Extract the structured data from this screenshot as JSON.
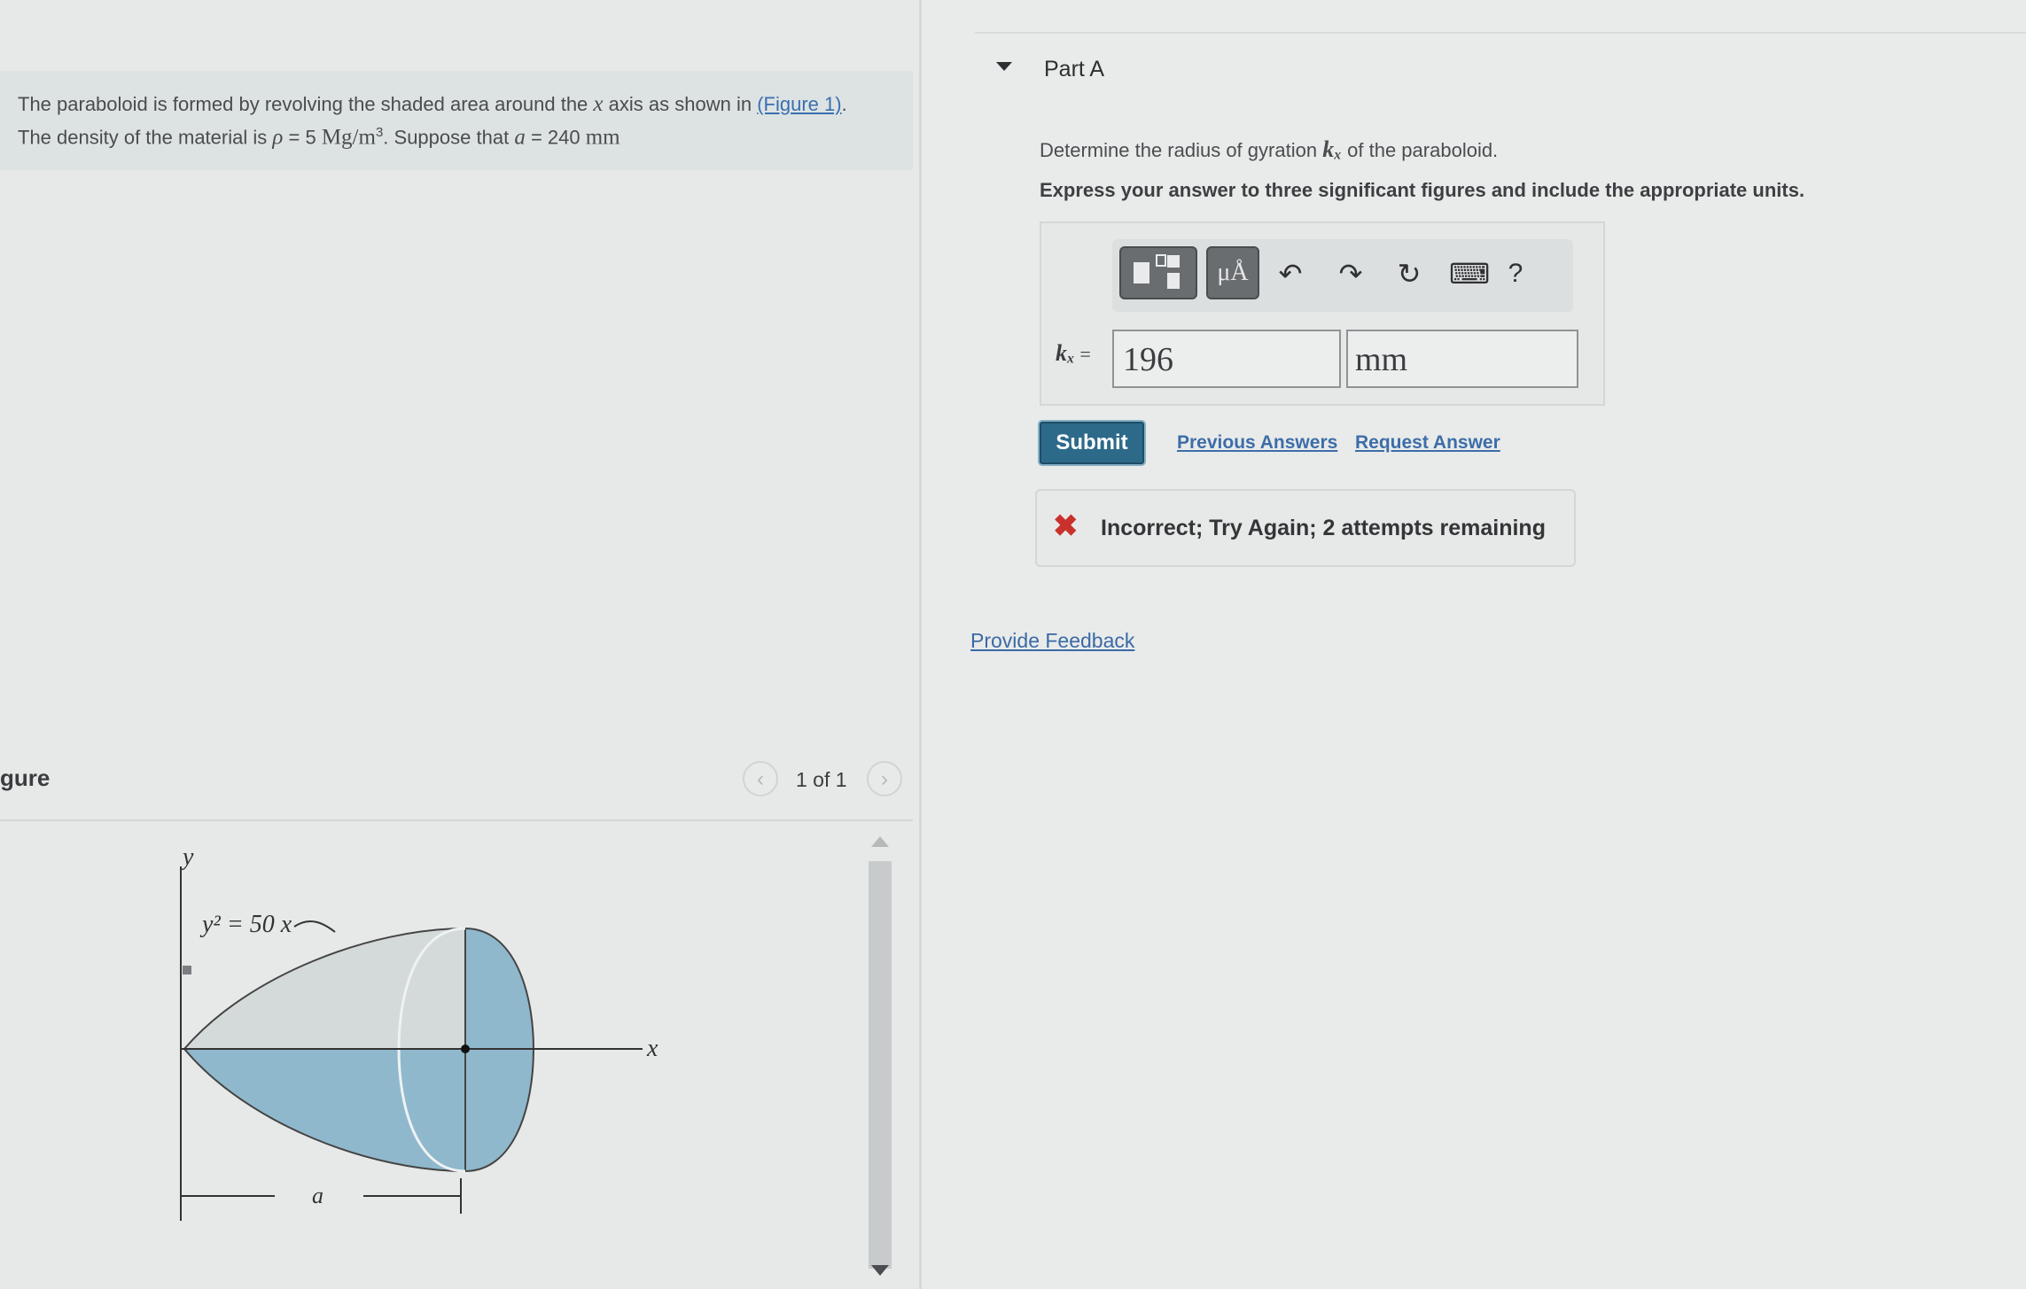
{
  "problem": {
    "line1_prefix": "The paraboloid is formed by revolving the shaded area around the",
    "axis": "x",
    "line1_mid": "axis as shown in",
    "figure_link": "(Figure 1)",
    "line1_end": ".",
    "line2_prefix": "The density of the material is",
    "rho_symbol": "ρ",
    "rho_value": "= 5",
    "rho_unit": "Mg/m",
    "rho_exp": "3",
    "line2_mid": ". Suppose that",
    "a_symbol": "a",
    "a_value": "= 240",
    "a_unit": "mm"
  },
  "figure": {
    "title": "gure",
    "pager_count": "1 of 1",
    "prev_glyph": "‹",
    "next_glyph": "›",
    "equation": "y² = 50 x",
    "y_axis_label": "y",
    "x_axis_label": "x",
    "a_label": "a"
  },
  "part": {
    "title": "Part A",
    "question_prefix": "Determine the radius of gyration",
    "question_var": "kₓ",
    "question_suffix": "of the paraboloid.",
    "instruction": "Express your answer to three significant figures and include the appropriate units."
  },
  "toolbar": {
    "units_label": "μÅ",
    "undo_glyph": "↶",
    "redo_glyph": "↷",
    "reset_glyph": "↻",
    "keyboard_glyph": "⌨",
    "help_glyph": "?"
  },
  "answer": {
    "label_var": "kₓ",
    "label_eq": "=",
    "value": "196",
    "unit": "mm"
  },
  "actions": {
    "submit": "Submit",
    "previous_answers": "Previous Answers",
    "request_answer": "Request Answer"
  },
  "feedback": {
    "icon": "✖",
    "message": "Incorrect; Try Again; 2 attempts remaining"
  },
  "footer": {
    "provide_feedback": "Provide Feedback"
  },
  "colors": {
    "submit_bg": "#2d6a8a",
    "link": "#3b6fb0",
    "error": "#c9322c",
    "shade": "#8fb8cc"
  }
}
